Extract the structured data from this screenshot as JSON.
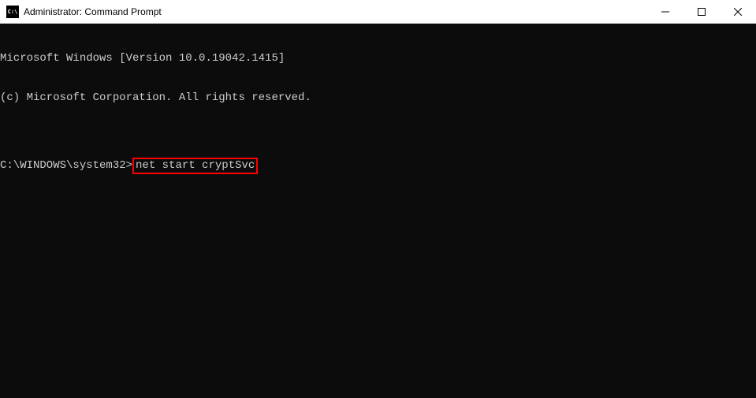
{
  "window": {
    "title": "Administrator: Command Prompt",
    "icon_label": "C:\\"
  },
  "terminal": {
    "line1": "Microsoft Windows [Version 10.0.19042.1415]",
    "line2": "(c) Microsoft Corporation. All rights reserved.",
    "blank": "",
    "prompt": "C:\\WINDOWS\\system32>",
    "command": "net start cryptSvc"
  }
}
